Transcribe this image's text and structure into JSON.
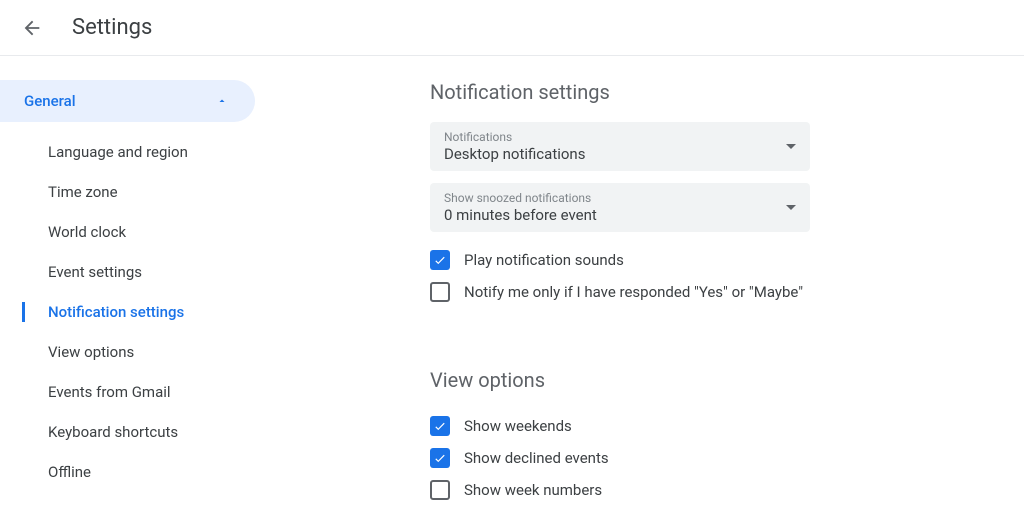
{
  "header": {
    "title": "Settings"
  },
  "sidebar": {
    "category": "General",
    "items": [
      {
        "label": "Language and region",
        "active": false
      },
      {
        "label": "Time zone",
        "active": false
      },
      {
        "label": "World clock",
        "active": false
      },
      {
        "label": "Event settings",
        "active": false
      },
      {
        "label": "Notification settings",
        "active": true
      },
      {
        "label": "View options",
        "active": false
      },
      {
        "label": "Events from Gmail",
        "active": false
      },
      {
        "label": "Keyboard shortcuts",
        "active": false
      },
      {
        "label": "Offline",
        "active": false
      }
    ]
  },
  "content": {
    "notifications": {
      "title": "Notification settings",
      "dropdown1": {
        "label": "Notifications",
        "value": "Desktop notifications"
      },
      "dropdown2": {
        "label": "Show snoozed notifications",
        "value": "0 minutes before event"
      },
      "check1": {
        "label": "Play notification sounds",
        "checked": true
      },
      "check2": {
        "label": "Notify me only if I have responded \"Yes\" or \"Maybe\"",
        "checked": false
      }
    },
    "view": {
      "title": "View options",
      "check1": {
        "label": "Show weekends",
        "checked": true
      },
      "check2": {
        "label": "Show declined events",
        "checked": true
      },
      "check3": {
        "label": "Show week numbers",
        "checked": false
      }
    }
  }
}
